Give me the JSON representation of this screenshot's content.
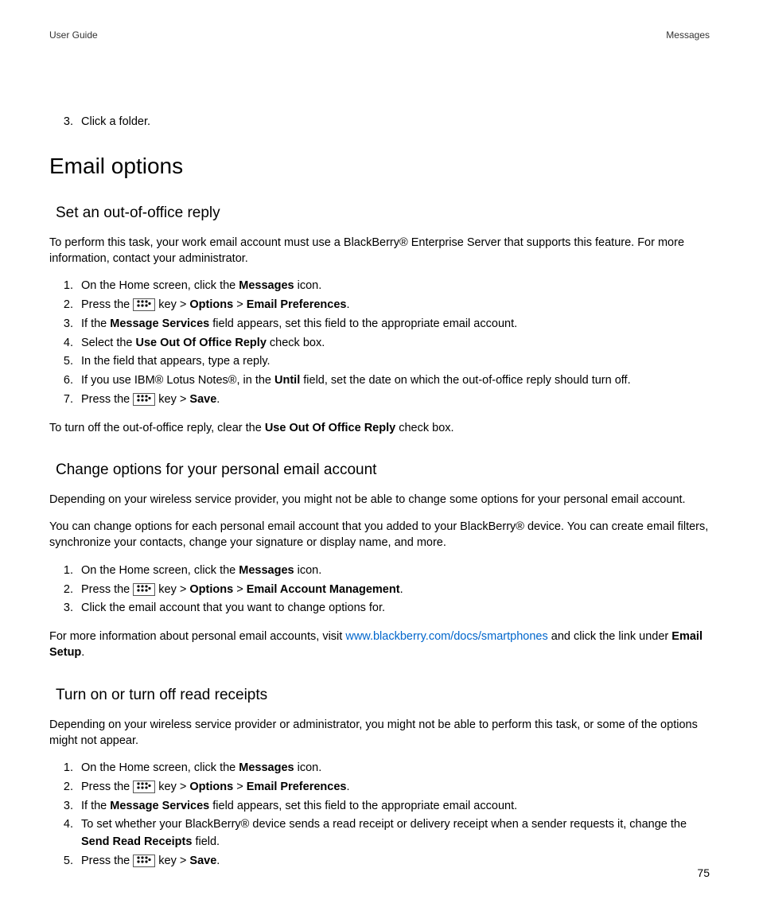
{
  "header": {
    "left": "User Guide",
    "right": "Messages"
  },
  "startList": {
    "num": "3",
    "text": "Click a folder."
  },
  "h1": "Email options",
  "s1": {
    "title": "Set an out-of-office reply",
    "intro": "To perform this task, your work email account must use a BlackBerry® Enterprise Server that supports this feature. For more information, contact your administrator.",
    "step1a": "On the Home screen, click the ",
    "step1b": "Messages",
    "step1c": " icon.",
    "step2a": "Press the ",
    "step2b": " key > ",
    "step2c": "Options",
    "step2d": " > ",
    "step2e": "Email Preferences",
    "step2f": ".",
    "step3a": "If the ",
    "step3b": "Message Services",
    "step3c": " field appears, set this field to the appropriate email account.",
    "step4a": "Select the ",
    "step4b": "Use Out Of Office Reply",
    "step4c": " check box.",
    "step5": "In the field that appears, type a reply.",
    "step6a": "If you use IBM® Lotus Notes®, in the ",
    "step6b": "Until",
    "step6c": " field, set the date on which the out-of-office reply should turn off.",
    "step7a": "Press the ",
    "step7b": " key > ",
    "step7c": "Save",
    "step7d": ".",
    "outroA": "To turn off the out-of-office reply, clear the ",
    "outroB": "Use Out Of Office Reply",
    "outroC": " check box."
  },
  "s2": {
    "title": "Change options for your personal email account",
    "p1": "Depending on your wireless service provider, you might not be able to change some options for your personal email account.",
    "p2": "You can change options for each personal email account that you added to your BlackBerry® device. You can create email filters, synchronize your contacts, change your signature or display name, and more.",
    "step1a": "On the Home screen, click the ",
    "step1b": "Messages",
    "step1c": " icon.",
    "step2a": "Press the ",
    "step2b": " key > ",
    "step2c": "Options",
    "step2d": " > ",
    "step2e": "Email Account Management",
    "step2f": ".",
    "step3": "Click the email account that you want to change options for.",
    "outroA": "For more information about personal email accounts, visit ",
    "link": "www.blackberry.com/docs/smartphones",
    "outroB": " and click the link under ",
    "outroC": "Email Setup",
    "outroD": "."
  },
  "s3": {
    "title": "Turn on or turn off read receipts",
    "intro": "Depending on your wireless service provider or administrator, you might not be able to perform this task, or some of the options might not appear.",
    "step1a": "On the Home screen, click the ",
    "step1b": "Messages",
    "step1c": " icon.",
    "step2a": "Press the ",
    "step2b": " key > ",
    "step2c": "Options",
    "step2d": " > ",
    "step2e": "Email Preferences",
    "step2f": ".",
    "step3a": "If the ",
    "step3b": "Message Services",
    "step3c": " field appears, set this field to the appropriate email account.",
    "step4a": "To set whether your BlackBerry® device sends a read receipt or delivery receipt when a sender requests it, change the ",
    "step4b": "Send Read Receipts",
    "step4c": " field.",
    "step5a": "Press the ",
    "step5b": " key > ",
    "step5c": "Save",
    "step5d": "."
  },
  "pageNum": "75"
}
